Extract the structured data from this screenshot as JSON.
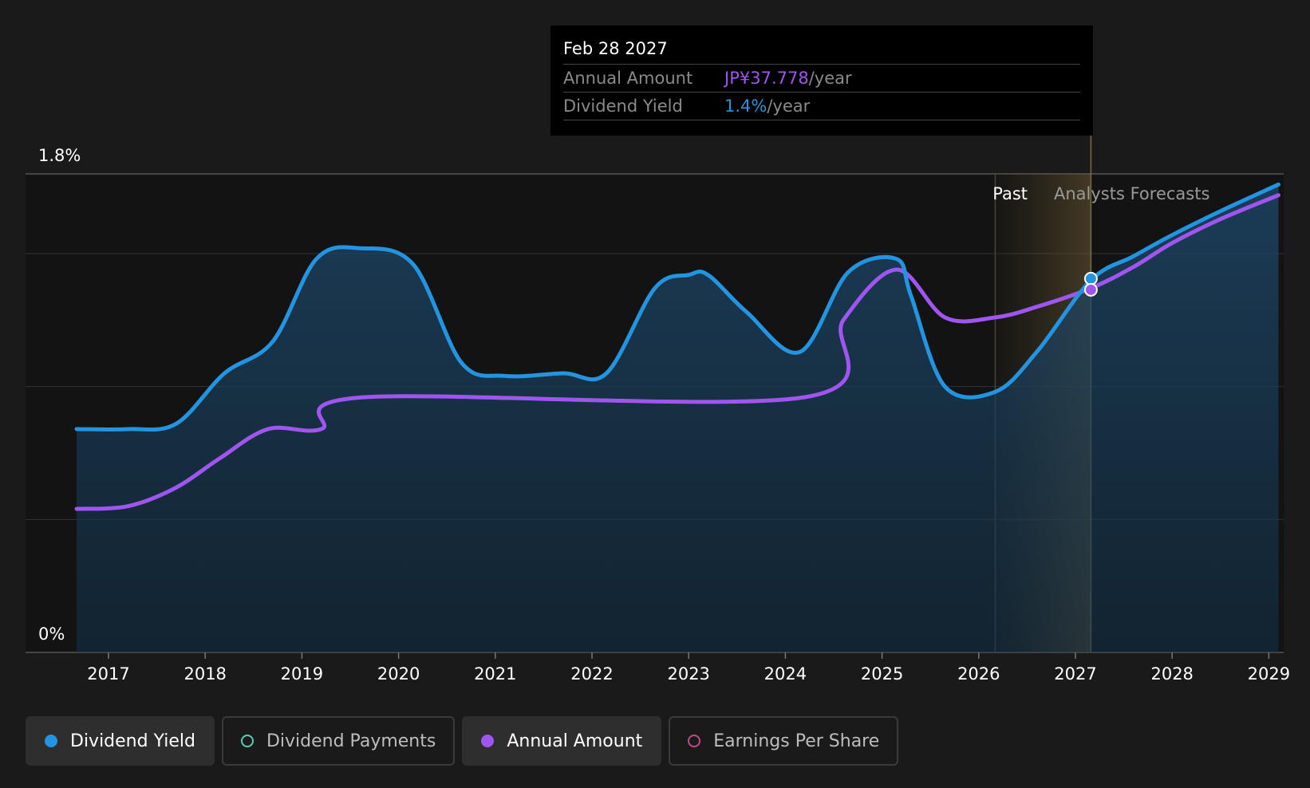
{
  "chart_data": {
    "type": "area",
    "y_axis": {
      "label_top": "1.8%",
      "label_bottom": "0%",
      "range": [
        0,
        1.8
      ]
    },
    "x_axis": {
      "ticks": [
        "2017",
        "2018",
        "2019",
        "2020",
        "2021",
        "2022",
        "2023",
        "2024",
        "2025",
        "2026",
        "2027",
        "2028",
        "2029"
      ]
    },
    "regions": {
      "past": "Past",
      "forecast": "Analysts Forecasts",
      "past_end": 2026.17,
      "forecast_marker": 2027.16
    },
    "series": [
      {
        "name": "Dividend Yield",
        "color": "#2394df",
        "points": [
          [
            2016.67,
            0.84
          ],
          [
            2017.2,
            0.84
          ],
          [
            2017.7,
            0.86
          ],
          [
            2018.2,
            1.05
          ],
          [
            2018.7,
            1.17
          ],
          [
            2019.15,
            1.48
          ],
          [
            2019.6,
            1.52
          ],
          [
            2020.15,
            1.46
          ],
          [
            2020.65,
            1.09
          ],
          [
            2021.1,
            1.04
          ],
          [
            2021.7,
            1.05
          ],
          [
            2022.15,
            1.05
          ],
          [
            2022.65,
            1.37
          ],
          [
            2023.0,
            1.42
          ],
          [
            2023.2,
            1.42
          ],
          [
            2023.6,
            1.28
          ],
          [
            2024.15,
            1.13
          ],
          [
            2024.65,
            1.43
          ],
          [
            2025.15,
            1.48
          ],
          [
            2025.3,
            1.34
          ],
          [
            2025.65,
            1.0
          ],
          [
            2026.17,
            0.98
          ],
          [
            2026.6,
            1.13
          ],
          [
            2027.16,
            1.4
          ],
          [
            2027.6,
            1.49
          ],
          [
            2028.0,
            1.57
          ],
          [
            2028.5,
            1.66
          ],
          [
            2029.1,
            1.76
          ]
        ]
      },
      {
        "name": "Annual Amount",
        "color": "#9f55ef",
        "points": [
          [
            2016.67,
            0.54
          ],
          [
            2017.2,
            0.55
          ],
          [
            2017.7,
            0.62
          ],
          [
            2018.15,
            0.73
          ],
          [
            2018.65,
            0.84
          ],
          [
            2019.2,
            0.84
          ],
          [
            2019.65,
            0.96
          ],
          [
            2024.2,
            0.96
          ],
          [
            2024.6,
            1.25
          ],
          [
            2025.15,
            1.44
          ],
          [
            2025.65,
            1.26
          ],
          [
            2026.17,
            1.26
          ],
          [
            2026.6,
            1.3
          ],
          [
            2027.16,
            1.37
          ],
          [
            2027.6,
            1.45
          ],
          [
            2028.0,
            1.54
          ],
          [
            2028.5,
            1.63
          ],
          [
            2029.1,
            1.72
          ]
        ]
      }
    ],
    "tooltip": {
      "date": "Feb 28 2027",
      "annual_amount_label": "Annual Amount",
      "annual_amount_value": "JP¥37.778",
      "dividend_yield_label": "Dividend Yield",
      "dividend_yield_value": "1.4%",
      "unit": "/year"
    }
  },
  "legend": [
    {
      "label": "Dividend Yield",
      "color": "#2394df",
      "active": true
    },
    {
      "label": "Dividend Payments",
      "color": "#5ec9b8",
      "active": false
    },
    {
      "label": "Annual Amount",
      "color": "#9f55ef",
      "active": true
    },
    {
      "label": "Earnings Per Share",
      "color": "#c04a8a",
      "active": false
    }
  ]
}
